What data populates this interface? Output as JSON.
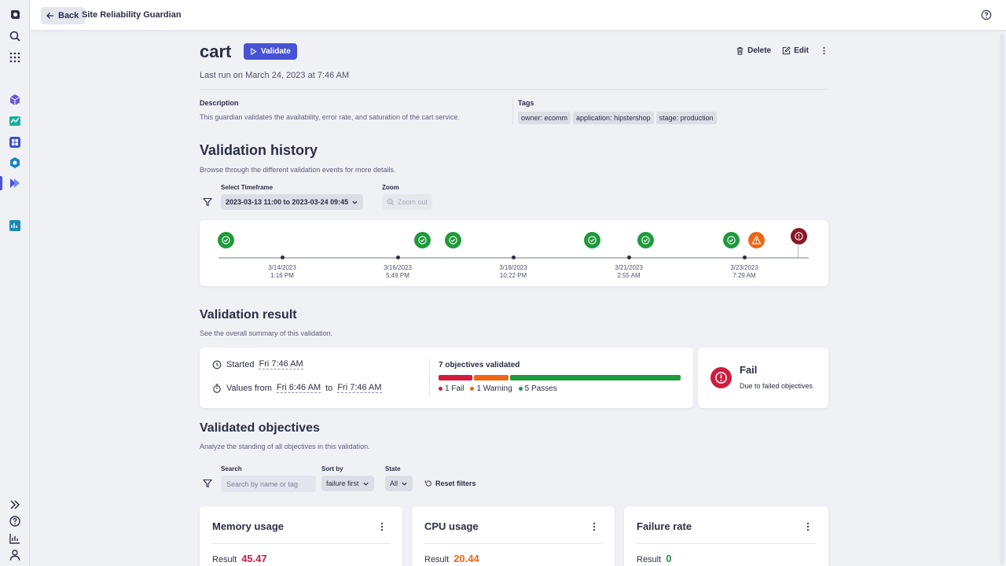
{
  "topbar": {
    "back_label": "Back",
    "app_title": "Site Reliability Guardian"
  },
  "header": {
    "title": "cart",
    "validate_label": "Validate",
    "delete_label": "Delete",
    "edit_label": "Edit",
    "last_run": "Last run on March 24, 2023 at 7:46 AM"
  },
  "details": {
    "description_label": "Description",
    "description": "This guardian validates the availability, error rate, and saturation of the cart service.",
    "tags_label": "Tags",
    "tags": [
      "owner: ecomm",
      "application: hipstershop",
      "stage: production"
    ]
  },
  "history": {
    "title": "Validation history",
    "subtitle": "Browse through the different validation events for more details.",
    "timeframe_label": "Select Timeframe",
    "timeframe_value": "2023-03-13 11:00 to 2023-03-24 09:45",
    "zoom_label": "Zoom",
    "zoom_out_label": "Zoom out",
    "ticks": [
      {
        "date": "3/14/2023",
        "time": "1:16 PM"
      },
      {
        "date": "3/16/2023",
        "time": "5:49 PM"
      },
      {
        "date": "3/18/2023",
        "time": "10:22 PM"
      },
      {
        "date": "3/21/2023",
        "time": "2:55 AM"
      },
      {
        "date": "3/23/2023",
        "time": "7:29 AM"
      }
    ],
    "events": [
      "pass",
      "pass",
      "pass",
      "pass",
      "pass",
      "pass",
      "warning",
      "fail"
    ]
  },
  "result": {
    "title": "Validation result",
    "subtitle": "See the overall summary of this validation.",
    "started_label": "Started",
    "started_value": "Fri 7:46 AM",
    "values_from_label": "Values from",
    "values_from": "Fri 6:46 AM",
    "to_label": "to",
    "values_to": "Fri 7:46 AM",
    "objectives_validated": "7 objectives validated",
    "fail_count_label": "1 Fail",
    "warning_count_label": "1 Warning",
    "pass_count_label": "5 Passes",
    "fail_count": 1,
    "warning_count": 1,
    "pass_count": 5,
    "status": "Fail",
    "status_reason": "Due to failed objectives"
  },
  "objectives": {
    "title": "Validated objectives",
    "subtitle": "Analyze the standing of all objectives in this validation.",
    "search_label": "Search",
    "search_placeholder": "Search by name or tag",
    "sort_label": "Sort by",
    "sort_value": "failure first",
    "state_label": "State",
    "state_value": "All",
    "reset_label": "Reset filters",
    "result_label": "Result",
    "items": [
      {
        "name": "Memory usage",
        "value": "45.47",
        "status": "fail"
      },
      {
        "name": "CPU usage",
        "value": "20.44",
        "status": "warning"
      },
      {
        "name": "Failure rate",
        "value": "0",
        "status": "pass"
      }
    ]
  },
  "colors": {
    "accent": "#4753d4",
    "fail": "#d21b3c",
    "warning": "#f06514",
    "pass": "#1f9a3b"
  }
}
